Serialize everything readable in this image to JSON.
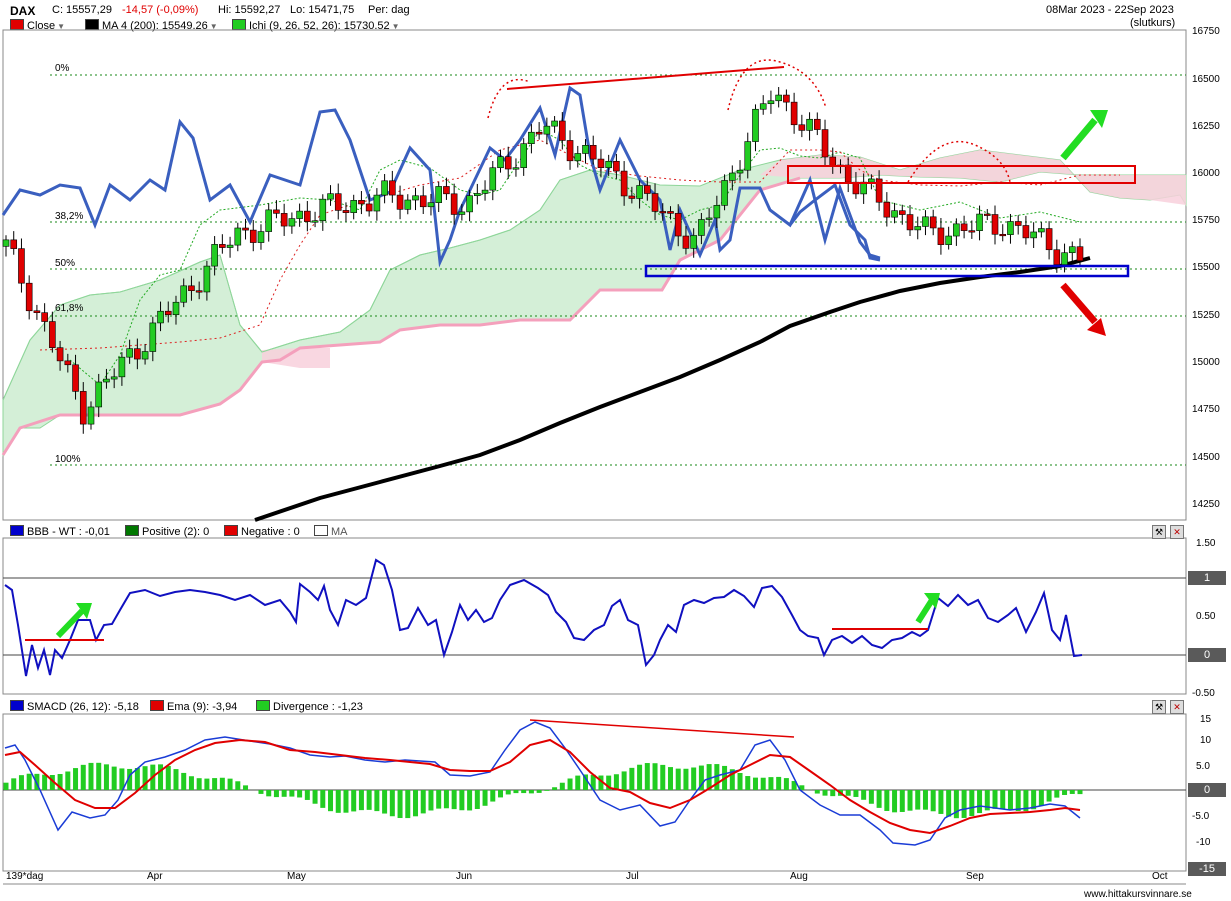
{
  "header": {
    "symbol": "DAX",
    "close": "C: 15557,29",
    "change": "-14,57 (-0,09%)",
    "high": "Hi: 15592,27",
    "low": "Lo: 15471,75",
    "period": "Per: dag",
    "date_range": "08Mar 2023 - 22Sep 2023",
    "price_type": "(slutkurs)"
  },
  "legend_main": [
    {
      "label": "Close",
      "color": "#e00000"
    },
    {
      "label": "MA 4 (200): 15549.26",
      "color": "#000000"
    },
    {
      "label": "Ichi (9, 26, 52, 26): 15730.52",
      "color": "#22cc22"
    }
  ],
  "fib_labels": [
    "0%",
    "38,2%",
    "50%",
    "61,8%",
    "100%"
  ],
  "main_axis": [
    "16750",
    "16500",
    "16250",
    "16000",
    "15750",
    "15500",
    "15250",
    "15000",
    "14750",
    "14500",
    "14250"
  ],
  "legend_bbb": [
    {
      "label": "BBB - WT : -0,01",
      "color": "#0000cc"
    },
    {
      "label": "Positive (2): 0",
      "color": "#007700"
    },
    {
      "label": "Negative : 0",
      "color": "#e00000"
    },
    {
      "label": "MA",
      "color": "#ffffff"
    }
  ],
  "bbb_axis": [
    "1.50",
    "1",
    "0.50",
    "0",
    "-0.50"
  ],
  "legend_macd": [
    {
      "label": "SMACD (26, 12): -5,18",
      "color": "#0000cc"
    },
    {
      "label": "Ema (9): -3,94",
      "color": "#e00000"
    },
    {
      "label": "Divergence : -1,23",
      "color": "#22cc22"
    }
  ],
  "macd_axis": [
    "15",
    "10",
    "5.0",
    "0",
    "-5.0",
    "-10",
    "-15"
  ],
  "x_axis": [
    "139*dag",
    "Apr",
    "May",
    "Jun",
    "Jul",
    "Aug",
    "Sep",
    "Oct"
  ],
  "footer": "www.hittakursvinnare.se",
  "chart_data": {
    "type": "line",
    "title": "DAX",
    "y_range": [
      14150,
      16800
    ],
    "close_x": [
      "Mar 8",
      "Mar 20",
      "Apr 3",
      "Apr 17",
      "May 2",
      "May 15",
      "May 29",
      "Jun 12",
      "Jun 26",
      "Jul 10",
      "Jul 24",
      "Aug 7",
      "Aug 21",
      "Sep 4",
      "Sep 22"
    ],
    "close": [
      15630,
      14750,
      15220,
      15700,
      15820,
      15900,
      15860,
      16280,
      16000,
      15650,
      16480,
      15990,
      15700,
      15760,
      15557
    ],
    "ma200": {
      "start": 14200,
      "end": 15549.26
    },
    "fibonacci": {
      "0%": 16530,
      "38,2%": 15730,
      "50%": 15500,
      "61,8%": 15260,
      "100%": 14470
    },
    "zones": {
      "resistance": [
        15970,
        16050
      ],
      "support": [
        15480,
        15530
      ]
    },
    "bbb_range": [
      -0.5,
      1.5
    ],
    "bbb_last": -0.01,
    "smacd_range": [
      -15,
      15
    ],
    "smacd_last": -5.18,
    "ema_last": -3.94,
    "divergence_last": -1.23
  }
}
